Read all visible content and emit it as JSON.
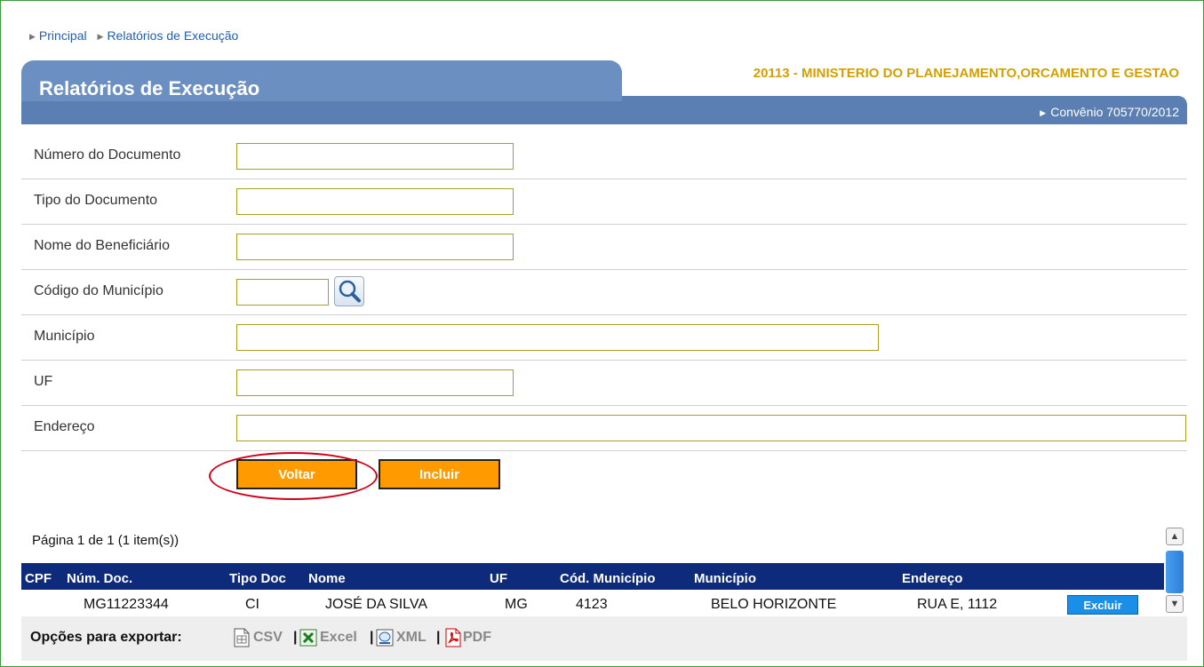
{
  "breadcrumb": [
    "Principal",
    "Relatórios de Execução"
  ],
  "header": {
    "title": "Relatórios de Execução",
    "organization": "20113 - MINISTERIO DO PLANEJAMENTO,ORCAMENTO E GESTAO",
    "convenio": "Convênio 705770/2012"
  },
  "form": {
    "numero_documento": {
      "label": "Número do Documento",
      "value": ""
    },
    "tipo_documento": {
      "label": "Tipo do Documento",
      "value": ""
    },
    "nome_beneficiario": {
      "label": "Nome do Beneficiário",
      "value": ""
    },
    "codigo_municipio": {
      "label": "Código do Município",
      "value": ""
    },
    "municipio": {
      "label": "Município",
      "value": ""
    },
    "uf": {
      "label": "UF",
      "value": ""
    },
    "endereco": {
      "label": "Endereço",
      "value": ""
    }
  },
  "buttons": {
    "voltar": "Voltar",
    "incluir": "Incluir"
  },
  "pager": "Página 1 de 1 (1 item(s))",
  "table": {
    "columns": [
      "CPF",
      "Núm. Doc.",
      "Tipo Doc",
      "Nome",
      "UF",
      "Cód. Município",
      "Município",
      "Endereço"
    ],
    "rows": [
      {
        "cpf": "",
        "num_doc": "MG11223344",
        "tipo_doc": "CI",
        "nome": "JOSÉ DA SILVA",
        "uf": "MG",
        "cod_municipio": "4123",
        "municipio": "BELO HORIZONTE",
        "endereco": "RUA E, 1112",
        "action": "Excluir"
      }
    ]
  },
  "export": {
    "label": "Opções para exportar:",
    "options": [
      "CSV",
      "Excel",
      "XML",
      "PDF"
    ],
    "icons": [
      "csv-icon",
      "excel-icon",
      "xml-icon",
      "pdf-icon"
    ]
  },
  "colors": {
    "header_blue": "#5b7fb3",
    "org_gold": "#d4a000",
    "button_orange": "#ff9a00",
    "table_header": "#0e2a7a",
    "highlight_red": "#d0001a"
  }
}
